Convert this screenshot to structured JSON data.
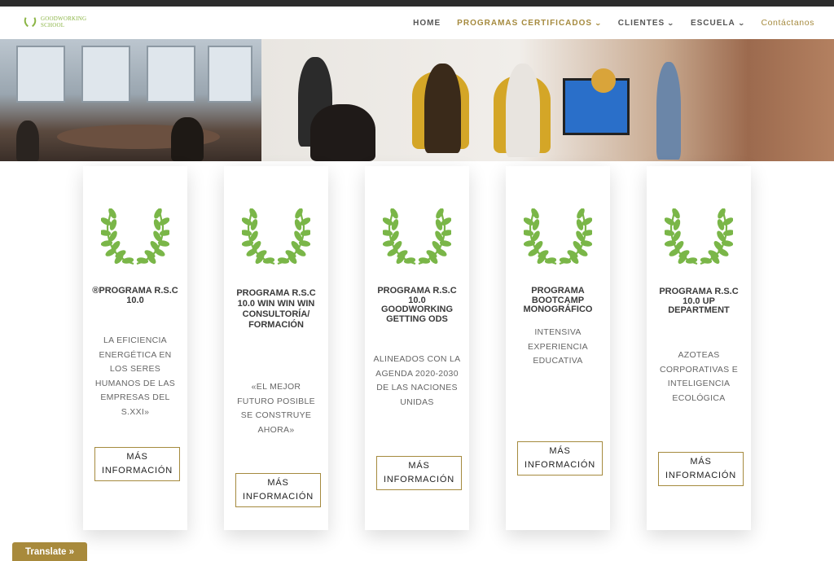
{
  "logo": {
    "line1": "GOODWORKING",
    "line2": "SCHOOL",
    "color": "#8bb545"
  },
  "nav": {
    "items": [
      {
        "label": "HOME"
      },
      {
        "label": "PROGRAMAS CERTIFICADOS"
      },
      {
        "label": "CLIENTES"
      },
      {
        "label": "ESCUELA"
      },
      {
        "label": "Contáctanos"
      }
    ],
    "accent_color": "#a58a3e"
  },
  "cards": [
    {
      "title": "®PROGRAMA R.S.C 10.0",
      "description": "LA EFICIENCIA ENERGÉTICA EN LOS SERES HUMANOS DE LAS EMPRESAS DEL S.XXI»",
      "button": "MÁS INFORMACIÓN"
    },
    {
      "title": "PROGRAMA R.S.C 10.0 WIN WIN WIN CONSULTORÍA/ FORMACIÓN",
      "description": "«EL MEJOR FUTURO POSIBLE SE CONSTRUYE AHORA»",
      "button": "MÁS INFORMACIÓN"
    },
    {
      "title": "PROGRAMA R.S.C 10.0 GOODWORKING GETTING ODS",
      "description": "ALINEADOS CON LA AGENDA 2020-2030 DE LAS NACIONES UNIDAS",
      "button": "MÁS INFORMACIÓN"
    },
    {
      "title": "PROGRAMA BOOTCAMP MONOGRÁFICO",
      "description": "INTENSIVA EXPERIENCIA EDUCATIVA",
      "button": "MÁS INFORMACIÓN"
    },
    {
      "title": "PROGRAMA R.S.C 10.0 UP DEPARTMENT",
      "description": "AZOTEAS CORPORATIVAS E INTELIGENCIA ECOLÓGICA",
      "button": "MÁS INFORMACIÓN"
    }
  ],
  "wreath_color": "#7ab648",
  "translate": {
    "label": "Translate »"
  }
}
